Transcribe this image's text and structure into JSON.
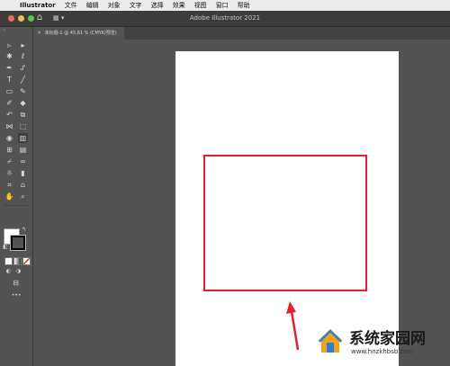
{
  "menubar": {
    "apple_icon": "",
    "app_name": "Illustrator",
    "items": [
      "文件",
      "编辑",
      "对象",
      "文字",
      "选择",
      "效果",
      "视图",
      "窗口",
      "帮助"
    ]
  },
  "titlebar": {
    "title": "Adobe Illustrator 2021",
    "home_icon": "home-icon",
    "workspace_icon": "workspace-switcher-icon"
  },
  "tab": {
    "label": "未标题-1 @ 45.61 % (CMYK/预览)",
    "close_glyph": "×"
  },
  "toolbar": {
    "tools": [
      "selection",
      "direct-selection",
      "magic-wand",
      "lasso",
      "pen",
      "curvature",
      "type",
      "line-segment",
      "rectangle",
      "paintbrush",
      "shaper",
      "eraser",
      "rotate",
      "scale",
      "width",
      "free-transform",
      "shape-builder",
      "perspective-grid",
      "mesh",
      "gradient",
      "eyedropper",
      "blend",
      "symbol-sprayer",
      "column-graph",
      "artboard",
      "slice",
      "hand",
      "zoom"
    ],
    "selected_tool": "perspective-grid",
    "fill_color": "#ffffff",
    "stroke_color": "#000000",
    "more_glyph": "•••"
  },
  "canvas": {
    "artboard_color": "#ffffff",
    "shape": {
      "type": "rectangle",
      "stroke_color": "#e3202c",
      "fill": "none"
    },
    "annotation_arrow_color": "#e3202c"
  },
  "watermark": {
    "title": "系统家园网",
    "url": "www.hnzkhbsb.com"
  }
}
